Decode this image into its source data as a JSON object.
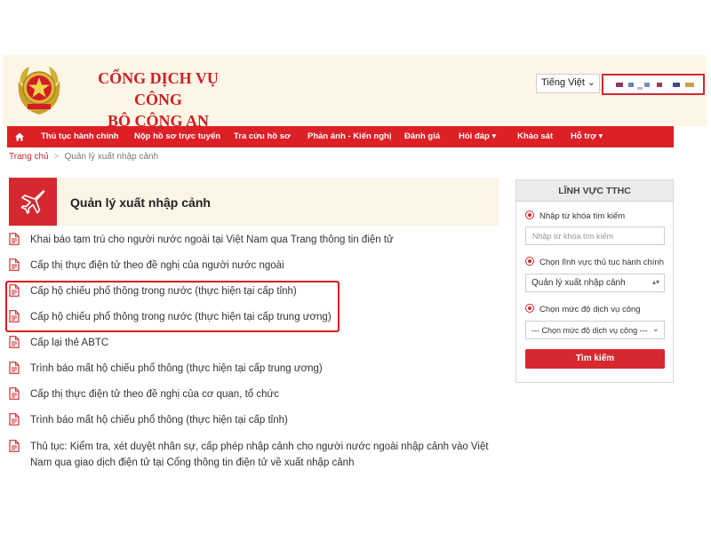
{
  "header": {
    "title_line1": "CỔNG DỊCH VỤ CÔNG",
    "title_line2": "BỘ CÔNG AN",
    "language": "Tiếng Việt"
  },
  "nav": {
    "items": [
      "Thủ tục hành chính",
      "Nộp hồ sơ trực tuyến",
      "Tra cứu hồ sơ",
      "Phản ánh - Kiến nghị",
      "Đánh giá",
      "Hỏi đáp ▾",
      "Khảo sát",
      "Hỗ trợ ▾"
    ]
  },
  "breadcrumb": {
    "home": "Trang chủ",
    "separator": ">",
    "current": "Quản lý xuất nhập cảnh"
  },
  "section": {
    "title": "Quản lý xuất nhập cảnh"
  },
  "procedures": [
    "Khai báo tạm trú cho người nước ngoài tại Việt Nam qua Trang thông tin điện tử",
    "Cấp thị thực điện tử theo đề nghị của người nước ngoài",
    "Cấp hộ chiếu phổ thông trong nước (thực hiện tại cấp tỉnh)",
    "Cấp hộ chiếu phổ thông trong nước (thực hiện tại cấp trung ương)",
    "Cấp lại thẻ ABTC",
    "Trình báo mất hộ chiếu phổ thông (thực hiện tại cấp trung ương)",
    "Cấp thị thực điện tử theo đề nghị của cơ quan, tổ chức",
    "Trình báo mất hộ chiếu phổ thông (thực hiện tại cấp tỉnh)",
    "Thủ tục: Kiểm tra, xét duyệt nhân sự, cấp phép nhập cảnh cho người nước ngoài nhập cảnh vào Việt Nam qua giao dịch điện tử tại Cổng thông tin điện tử về xuất nhập cảnh"
  ],
  "sidebar": {
    "title": "LĨNH VỰC TTHC",
    "keyword_label": "Nhập từ khóa tìm kiếm",
    "keyword_placeholder": "Nhập từ khóa tìm kiếm",
    "field_label": "Chọn lĩnh vực thủ tục hành chính",
    "field_value": "Quản lý xuất nhập cảnh",
    "level_label": "Chọn mức độ dịch vụ công",
    "level_value": "--- Chọn mức độ dịch vụ công ---",
    "search_button": "Tìm kiếm"
  },
  "colors": {
    "brand_red": "#d5292f",
    "nav_red": "#dd1f26",
    "header_bg": "#fdf6e6",
    "highlight": "#e0141b"
  }
}
